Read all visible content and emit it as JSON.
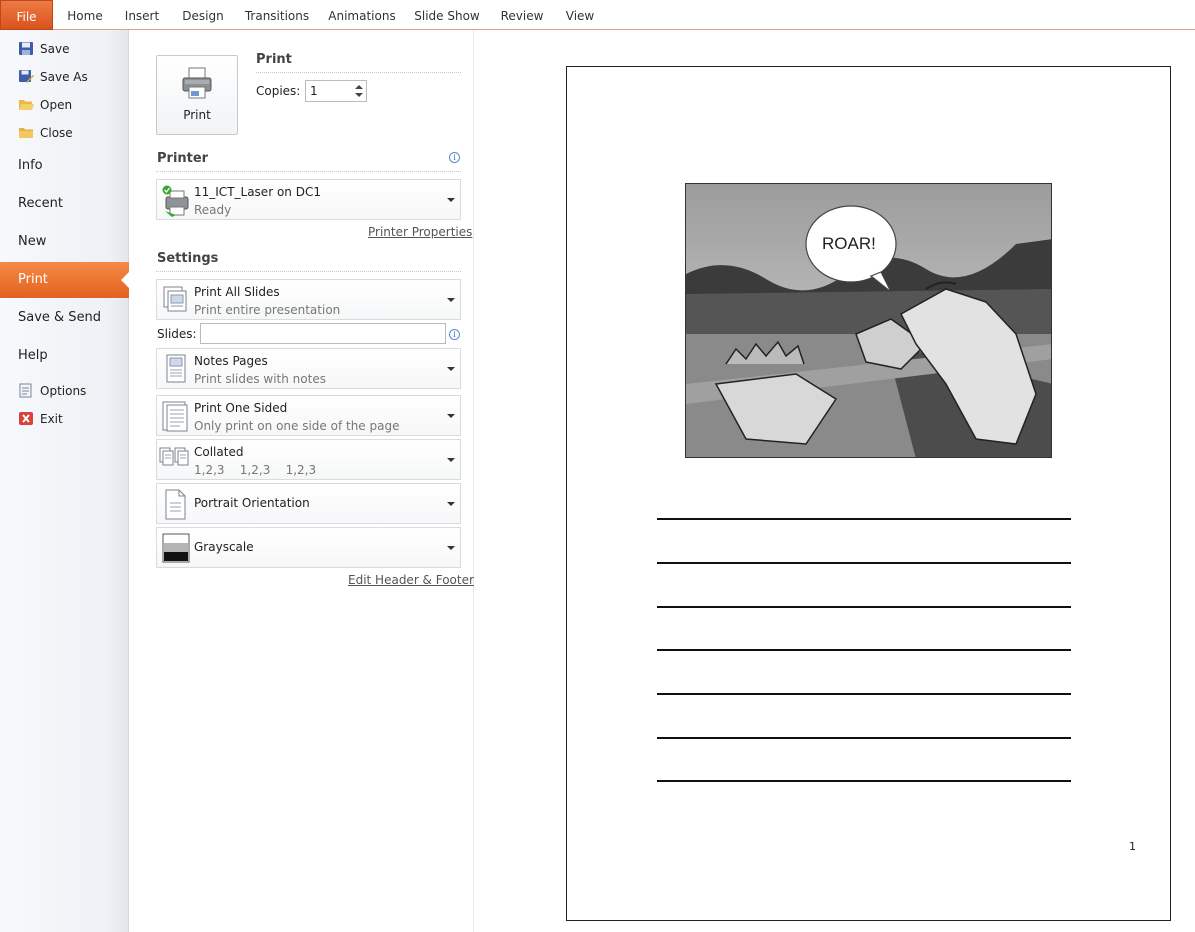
{
  "ribbon": {
    "tabs": [
      {
        "label": "File"
      },
      {
        "label": "Home"
      },
      {
        "label": "Insert"
      },
      {
        "label": "Design"
      },
      {
        "label": "Transitions"
      },
      {
        "label": "Animations"
      },
      {
        "label": "Slide Show"
      },
      {
        "label": "Review"
      },
      {
        "label": "View"
      }
    ]
  },
  "nav": {
    "save": "Save",
    "save_as": "Save As",
    "open": "Open",
    "close": "Close",
    "info": "Info",
    "recent": "Recent",
    "new": "New",
    "print": "Print",
    "save_send": "Save & Send",
    "help": "Help",
    "options": "Options",
    "exit": "Exit"
  },
  "print_section": {
    "button_label": "Print",
    "title": "Print",
    "copies_label": "Copies:",
    "copies_value": "1"
  },
  "printer": {
    "title": "Printer",
    "name": "11_ICT_Laser on DC1",
    "status": "Ready",
    "properties_link": "Printer Properties",
    "status_color": "#3aa82c"
  },
  "settings": {
    "title": "Settings",
    "range_main": "Print All Slides",
    "range_sub": "Print entire presentation",
    "slides_label": "Slides:",
    "slides_value": "",
    "layout_main": "Notes Pages",
    "layout_sub": "Print slides with notes",
    "sides_main": "Print One Sided",
    "sides_sub": "Only print on one side of the page",
    "collate_main": "Collated",
    "collate_sub": "1,2,3    1,2,3    1,2,3",
    "orientation_main": "Portrait Orientation",
    "color_main": "Grayscale",
    "header_footer_link": "Edit Header & Footer"
  },
  "preview": {
    "bubble_text": "ROAR!",
    "page_number": "1"
  },
  "colors": {
    "accent": "#e4621f",
    "file_tab": "#d9531c"
  }
}
